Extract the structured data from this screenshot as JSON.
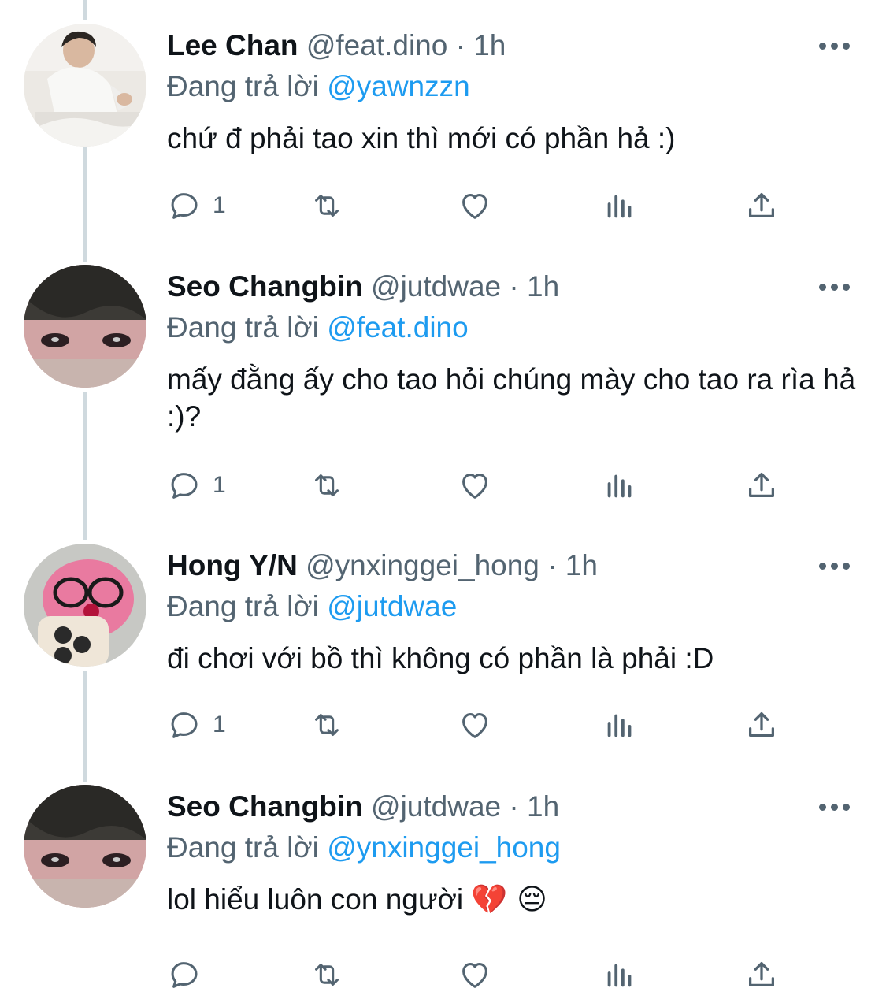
{
  "colors": {
    "link": "#1d9bf0",
    "secondary": "#536471",
    "text": "#0f1419",
    "thread_line": "#cfd9de"
  },
  "tweets": [
    {
      "name": "Lee Chan",
      "handle": "@feat.dino",
      "separator": "·",
      "time": "1h",
      "reply_prefix": "Đang trả lời",
      "reply_to": "@yawnzzn",
      "text": "chứ đ phải tao xin thì mới có phần hả :)",
      "reply_count": "1",
      "avatar_icon": "avatar-photo-person-white-shirt"
    },
    {
      "name": "Seo Changbin",
      "handle": "@jutdwae",
      "separator": "·",
      "time": "1h",
      "reply_prefix": "Đang trả lời",
      "reply_to": "@feat.dino",
      "text": "mấy đằng ấy cho tao hỏi chúng mày cho tao ra rìa hả :)?",
      "reply_count": "1",
      "avatar_icon": "avatar-photo-closeup-eyes"
    },
    {
      "name": "Hong Y/N",
      "handle": "@ynxinggei_hong",
      "separator": "·",
      "time": "1h",
      "reply_prefix": "Đang trả lời",
      "reply_to": "@jutdwae",
      "text": "đi chơi với bồ thì không có phần là phải :D",
      "reply_count": "1",
      "avatar_icon": "avatar-photo-pink-plush-glasses"
    },
    {
      "name": "Seo Changbin",
      "handle": "@jutdwae",
      "separator": "·",
      "time": "1h",
      "reply_prefix": "Đang trả lời",
      "reply_to": "@ynxinggei_hong",
      "text": "lol hiểu luôn con người",
      "emoji": "💔 😔",
      "reply_count": "",
      "avatar_icon": "avatar-photo-closeup-eyes"
    }
  ]
}
